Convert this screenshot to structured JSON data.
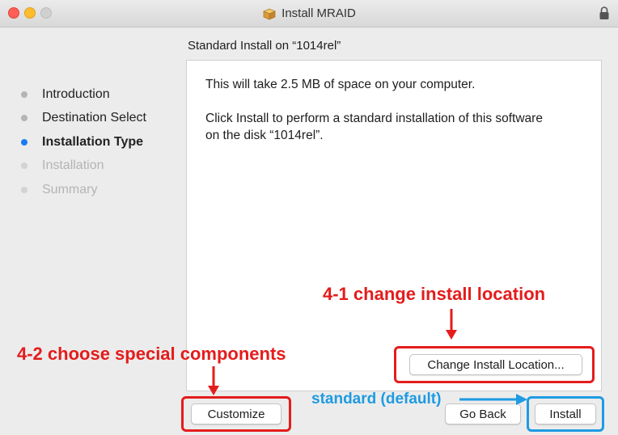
{
  "window": {
    "title": "Install MRAID",
    "icon": "package-icon",
    "lock": "lock-icon"
  },
  "subtitle": "Standard Install on “1014rel”",
  "steps": [
    {
      "label": "Introduction",
      "state": "done"
    },
    {
      "label": "Destination Select",
      "state": "done"
    },
    {
      "label": "Installation Type",
      "state": "active"
    },
    {
      "label": "Installation",
      "state": "pending"
    },
    {
      "label": "Summary",
      "state": "pending"
    }
  ],
  "content": {
    "space_text": "This will take 2.5 MB of space on your computer.",
    "instruction_line1": "Click Install to perform a standard installation of this software",
    "instruction_line2": "on the disk “1014rel”."
  },
  "buttons": {
    "change_location": "Change Install Location...",
    "customize": "Customize",
    "go_back": "Go Back",
    "install": "Install"
  },
  "annotations": {
    "change_location": "4-1 change install location",
    "special_components": "4-2 choose special components",
    "standard": "standard (default)",
    "red_color": "#e41c1c",
    "blue_color": "#1e9be2"
  },
  "colors": {
    "accent": "#1a7cf5",
    "close": "#fe5f57",
    "minimize": "#febc2e"
  }
}
